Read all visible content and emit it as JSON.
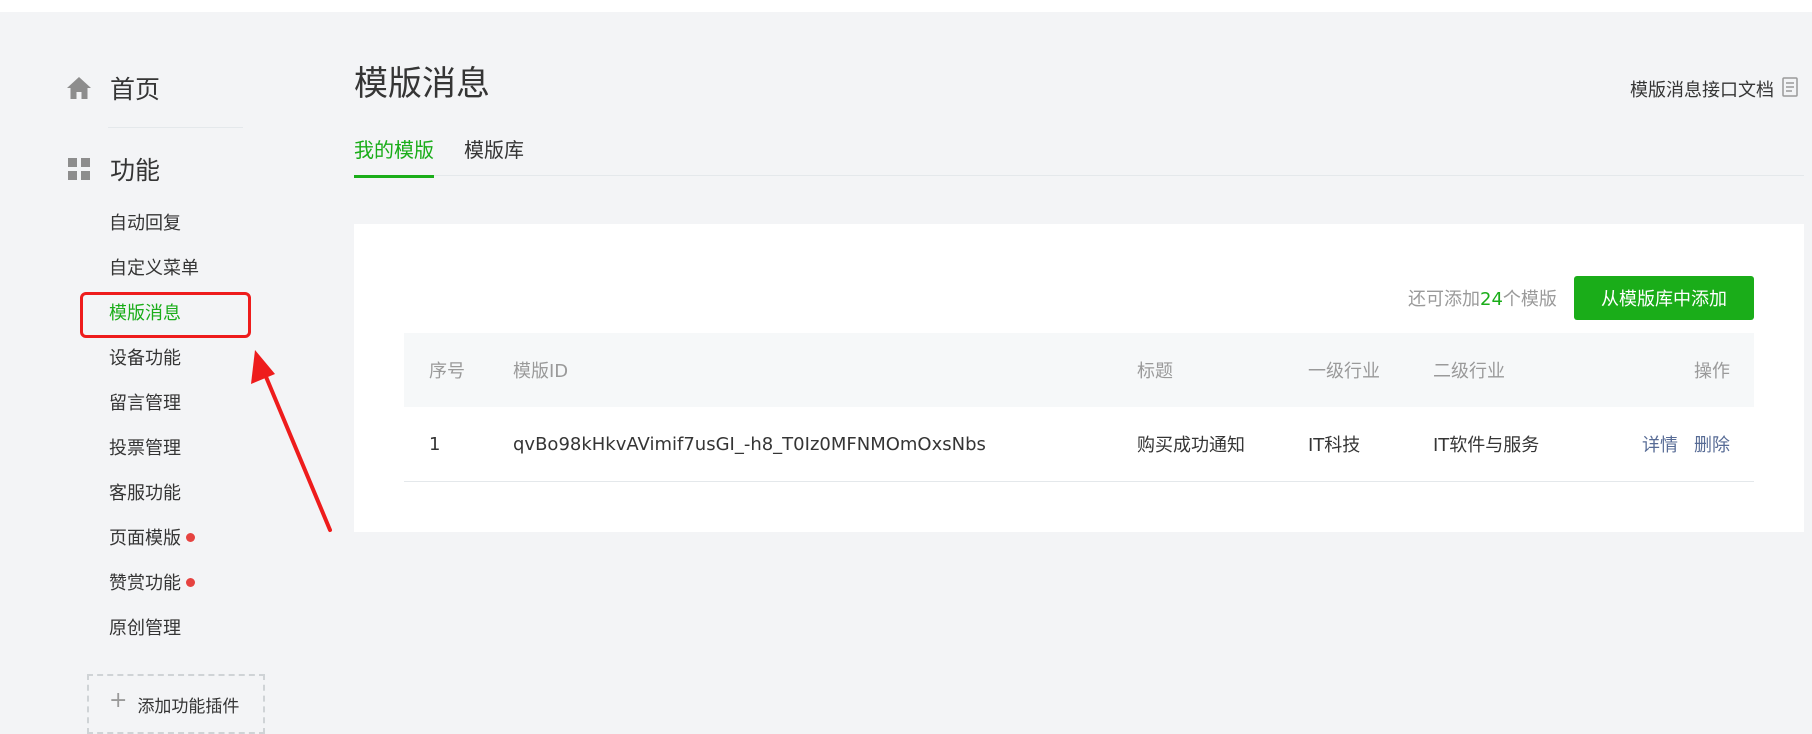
{
  "sidebar": {
    "home": {
      "label": "首页",
      "icon": "home-icon"
    },
    "features": {
      "label": "功能",
      "icon": "grid-icon"
    },
    "items": [
      {
        "label": "自动回复",
        "active": false,
        "dot": false
      },
      {
        "label": "自定义菜单",
        "active": false,
        "dot": false
      },
      {
        "label": "模版消息",
        "active": true,
        "dot": false
      },
      {
        "label": "设备功能",
        "active": false,
        "dot": false
      },
      {
        "label": "留言管理",
        "active": false,
        "dot": false
      },
      {
        "label": "投票管理",
        "active": false,
        "dot": false
      },
      {
        "label": "客服功能",
        "active": false,
        "dot": false
      },
      {
        "label": "页面模版",
        "active": false,
        "dot": true
      },
      {
        "label": "赞赏功能",
        "active": false,
        "dot": true
      },
      {
        "label": "原创管理",
        "active": false,
        "dot": false
      }
    ],
    "add_plugin": "添加功能插件"
  },
  "main": {
    "title": "模版消息",
    "doc_link": "模版消息接口文档",
    "tabs": [
      {
        "label": "我的模版",
        "active": true
      },
      {
        "label": "模版库",
        "active": false
      }
    ],
    "quota": {
      "prefix": "还可添加",
      "count": "24",
      "suffix": "个模版"
    },
    "add_button": "从模版库中添加",
    "table": {
      "headers": {
        "seq": "序号",
        "id": "模版ID",
        "title": "标题",
        "industry1": "一级行业",
        "industry2": "二级行业",
        "ops": "操作"
      },
      "rows": [
        {
          "seq": "1",
          "id": "qvBo98kHkvAVimif7usGI_-h8_T0Iz0MFNMOmOxsNbs",
          "title": "购买成功通知",
          "industry1": "IT科技",
          "industry2": "IT软件与服务",
          "detail": "详情",
          "delete": "删除"
        }
      ]
    }
  },
  "colors": {
    "accent": "#1aad19",
    "link": "#576b95",
    "annotation": "#ee1c1c",
    "badge": "#e64340"
  }
}
